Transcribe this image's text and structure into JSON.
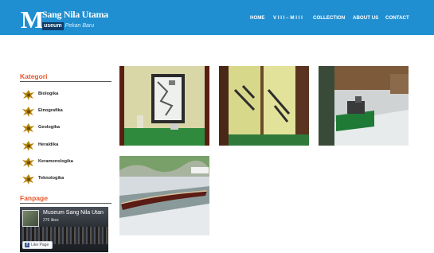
{
  "header": {
    "logo": {
      "letter": "M",
      "title": "Sang Nila Utama",
      "sub_a": "useum",
      "sub_b": "Pekan Baru"
    },
    "nav": [
      {
        "label": "HOME"
      },
      {
        "label": "V I I I – M I I I"
      },
      {
        "label": "COLLECTION"
      },
      {
        "label": "ABOUT US"
      },
      {
        "label": "CONTACT"
      }
    ]
  },
  "sidebar": {
    "kategori_title": "Kategori",
    "categories": [
      {
        "label": "Biologika"
      },
      {
        "label": "Etnografika"
      },
      {
        "label": "Geologika"
      },
      {
        "label": "Heraldika"
      },
      {
        "label": "Keramonologika"
      },
      {
        "label": "Teknologika"
      }
    ],
    "fanpage_title": "Fanpage",
    "fanpage": {
      "name": "Museum Sang Nila Utan",
      "likes": "276 likes",
      "like_button": "Like Page"
    }
  },
  "colors": {
    "header_bg": "#1f8fd1",
    "heading": "#e8562a"
  }
}
